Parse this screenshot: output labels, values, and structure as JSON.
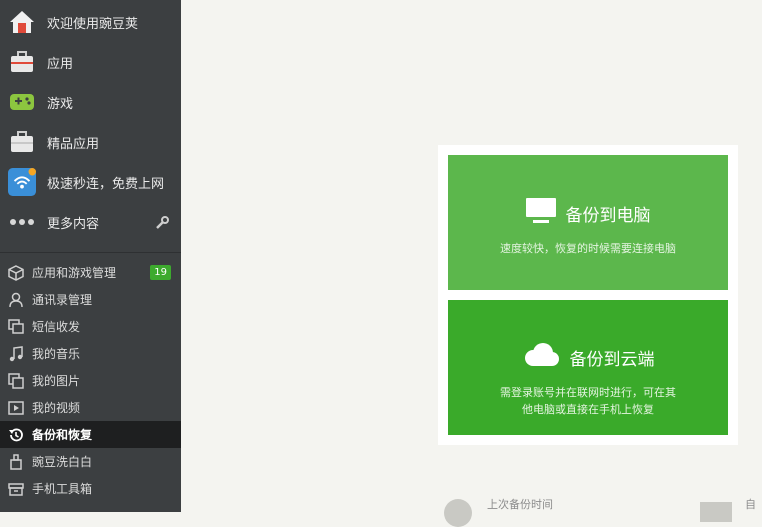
{
  "sidebar": {
    "top_items": [
      {
        "label": "欢迎使用豌豆荚",
        "icon": "home-icon"
      },
      {
        "label": "应用",
        "icon": "toolbox-icon"
      },
      {
        "label": "游戏",
        "icon": "gamepad-icon"
      },
      {
        "label": "精品应用",
        "icon": "toolbox-icon"
      },
      {
        "label": "极速秒连，免费上网",
        "icon": "wifi-app-icon"
      },
      {
        "label": "更多内容",
        "icon": "more-dots-icon",
        "action_icon": "wrench-icon"
      }
    ],
    "sub_items": [
      {
        "label": "应用和游戏管理",
        "icon": "cube-icon",
        "badge": "19"
      },
      {
        "label": "通讯录管理",
        "icon": "person-icon"
      },
      {
        "label": "短信收发",
        "icon": "message-icon"
      },
      {
        "label": "我的音乐",
        "icon": "music-icon"
      },
      {
        "label": "我的图片",
        "icon": "image-icon"
      },
      {
        "label": "我的视频",
        "icon": "video-icon"
      },
      {
        "label": "备份和恢复",
        "icon": "history-icon",
        "active": true
      },
      {
        "label": "豌豆洗白白",
        "icon": "clean-icon"
      },
      {
        "label": "手机工具箱",
        "icon": "toolbox-icon"
      }
    ]
  },
  "main": {
    "backup_pc": {
      "title": "备份到电脑",
      "desc": "速度较快，恢复的时候需要连接电脑",
      "icon": "monitor-icon"
    },
    "backup_cloud": {
      "title": "备份到云端",
      "desc_line1": "需登录账号并在联网时进行，可在其",
      "desc_line2": "他电脑或直接在手机上恢复",
      "icon": "cloud-icon"
    },
    "footer": {
      "last_backup_label": "上次备份时间",
      "right_label": "自"
    }
  },
  "colors": {
    "sidebar_bg": "#3c3f41",
    "active_bg": "#1e1f20",
    "card_pc": "#5cb74c",
    "card_cloud": "#3aaa2a",
    "badge": "#3daa2e"
  }
}
